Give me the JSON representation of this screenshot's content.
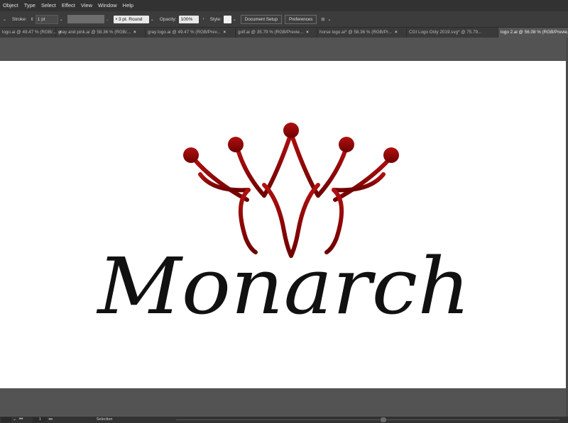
{
  "menu": [
    "Object",
    "Type",
    "Select",
    "Effect",
    "View",
    "Window",
    "Help"
  ],
  "control_bar": {
    "stroke_label": "Stroke:",
    "stroke_value": "1 pt",
    "brush_value": "3 pt. Round",
    "opacity_label": "Opacity:",
    "opacity_value": "100%",
    "style_label": "Style:",
    "document_setup": "Document Setup",
    "preferences": "Preferences"
  },
  "tabs": [
    {
      "label": "logo.ai @ 49.47 % (RGB/...",
      "active": false
    },
    {
      "label": "gray and pink.ai @ 58.36 % (RGB/...",
      "active": false
    },
    {
      "label": "gray logo.ai @ 49.47 % (RGB/Prev...",
      "active": false
    },
    {
      "label": "golf.ai @ 35.79 % (RGB/Previe...",
      "active": false
    },
    {
      "label": "horse logo.ai* @ 58.36 % (RGB/Pr...",
      "active": false
    },
    {
      "label": "CGI Logo Only 2019.svg* @ 75.79...",
      "active": false
    },
    {
      "label": "logo 2.ai @ 56.08 % (RGB/Previe...",
      "active": true
    }
  ],
  "tab_close_glyph": "×",
  "artwork": {
    "wordmark": "Monarch",
    "crown_color": "#8b0000",
    "text_color": "#111111"
  },
  "status": {
    "page": "1",
    "tool": "Selection"
  }
}
